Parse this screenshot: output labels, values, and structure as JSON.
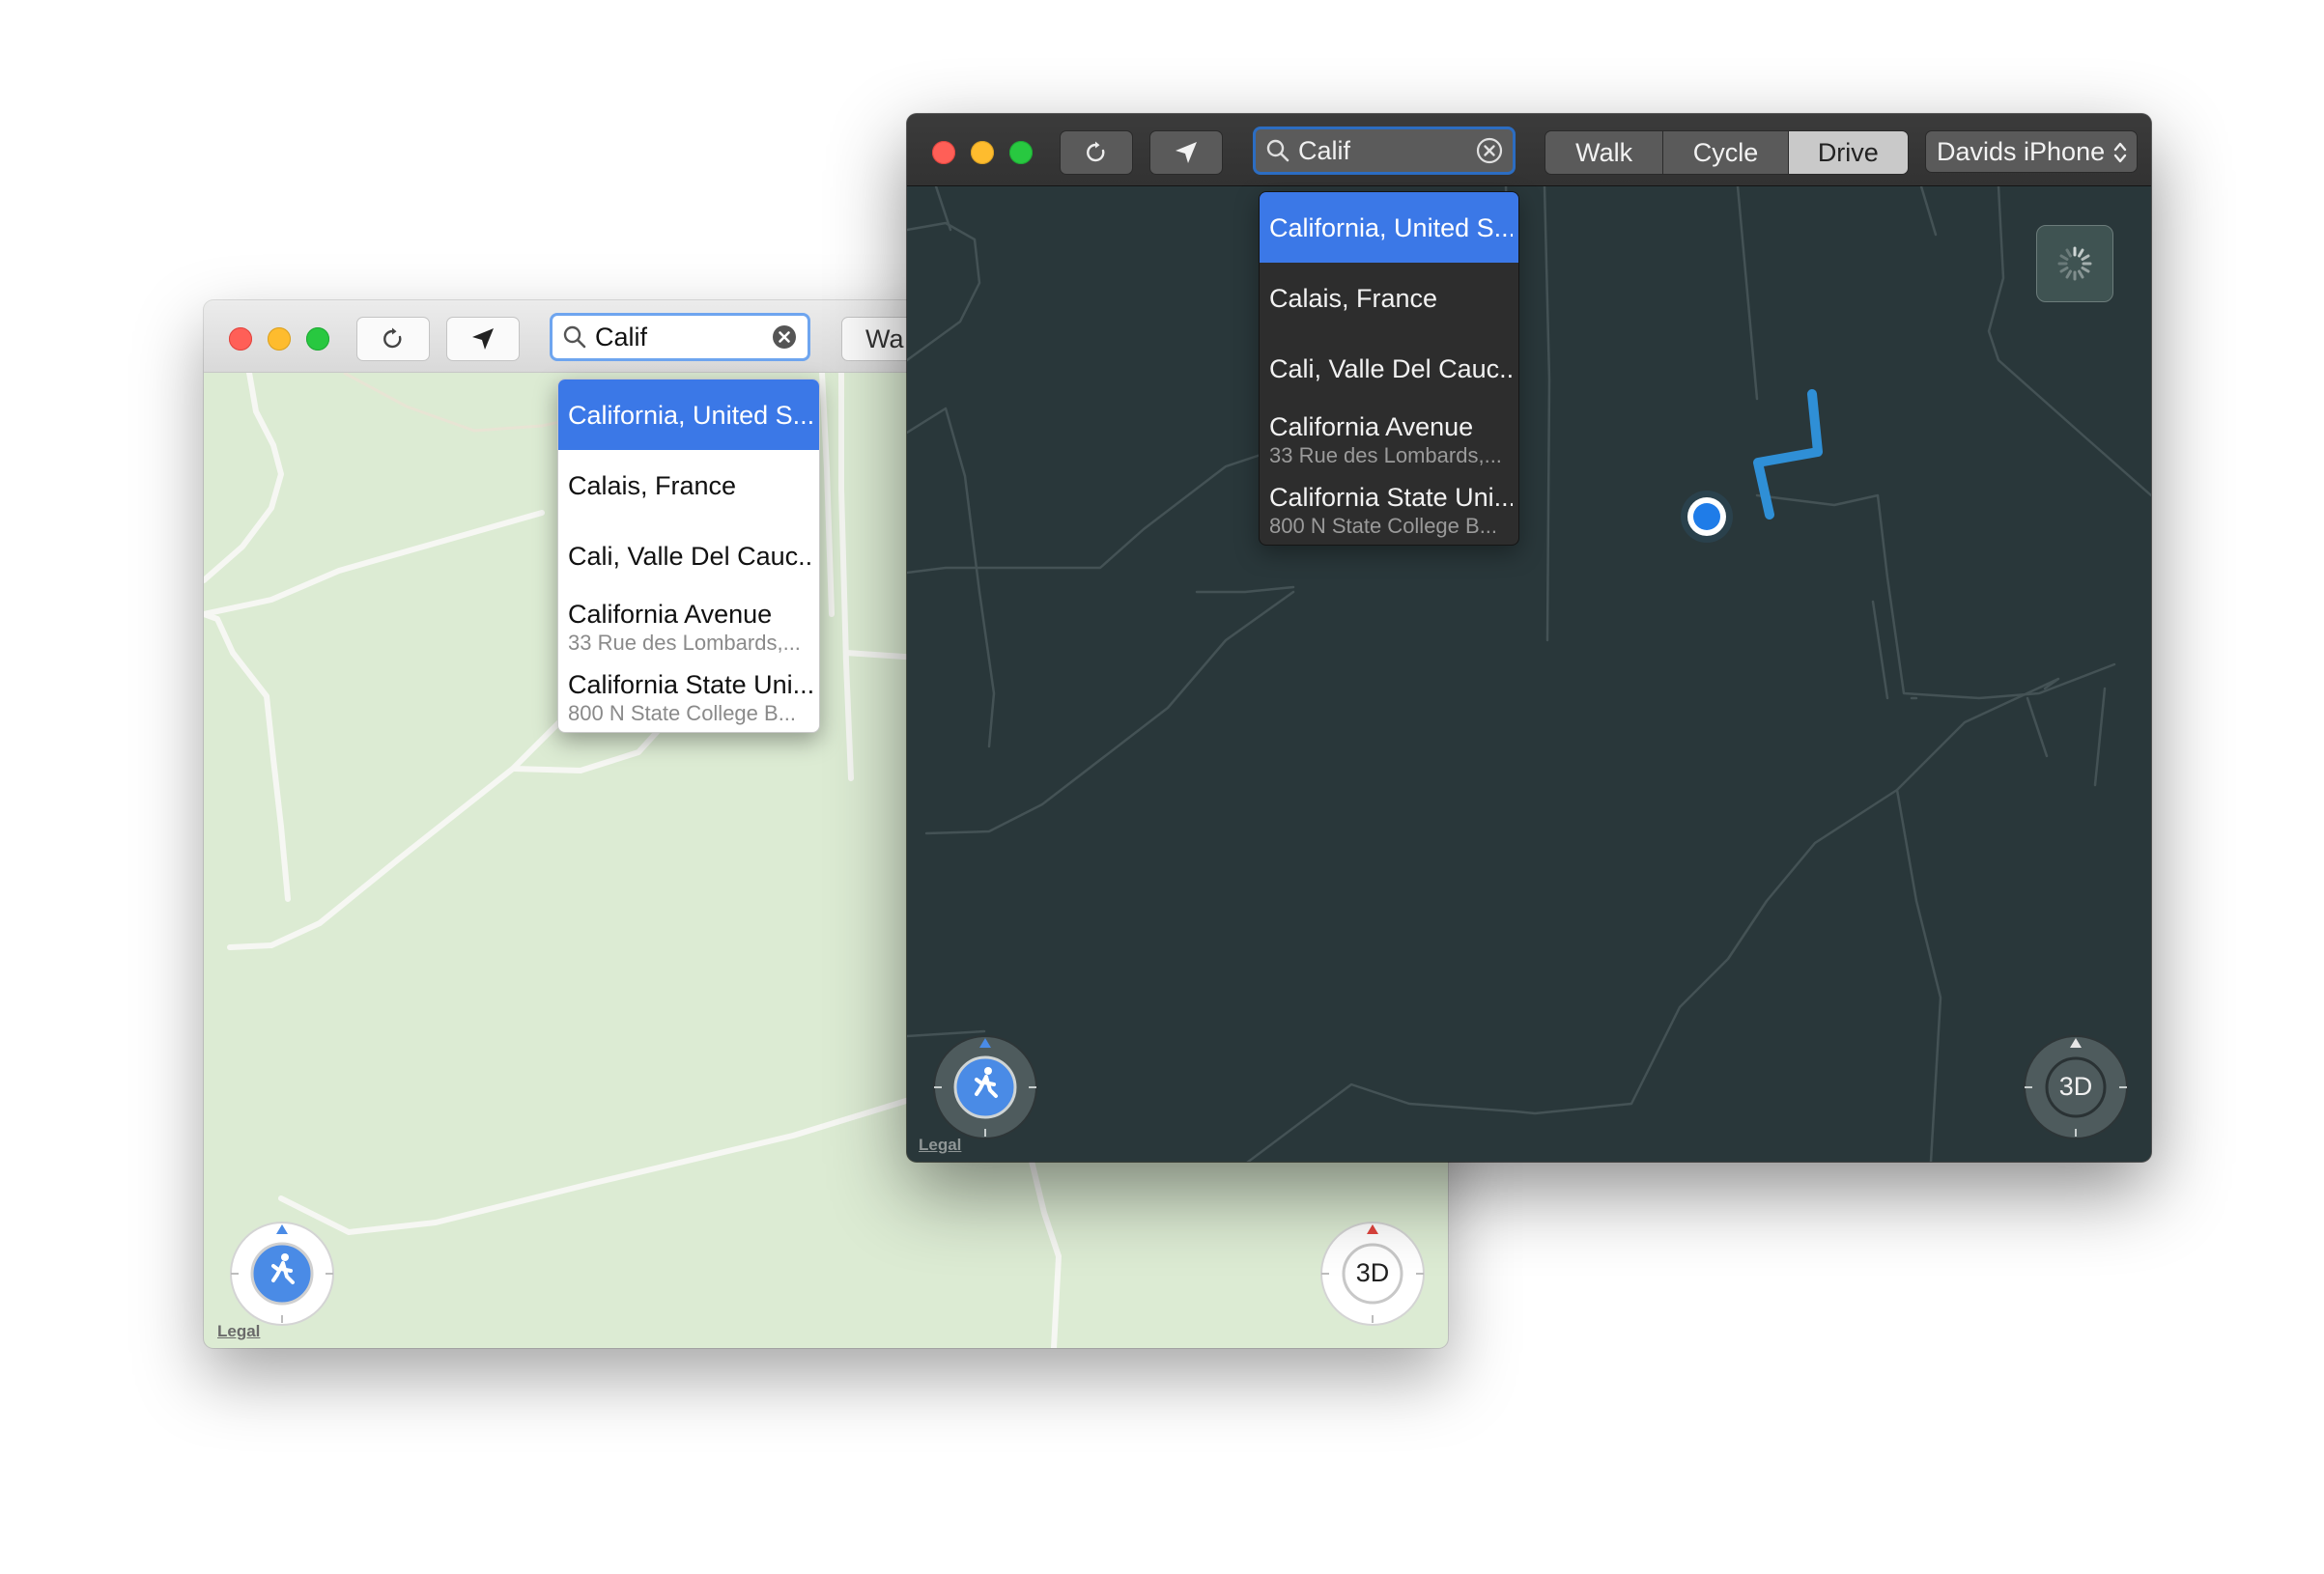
{
  "colors": {
    "accent_blue": "#3b78e7",
    "route_blue": "#2f8fd6",
    "light_map": "#dcebd3",
    "dark_map": "#29373a",
    "traffic_red": "#ff5f57",
    "traffic_yellow": "#febc2e",
    "traffic_green": "#28c840"
  },
  "light_window": {
    "toolbar": {
      "refresh_icon": "refresh-icon",
      "location_icon": "location-arrow-icon",
      "search": {
        "query": "Calif",
        "icon": "search-icon",
        "clear_icon": "clear-icon"
      },
      "transport_partial_label": "Wa"
    },
    "suggestions": [
      {
        "title": "California, United S...",
        "subtitle": "",
        "selected": true
      },
      {
        "title": "Calais, France",
        "subtitle": "",
        "selected": false
      },
      {
        "title": "Cali, Valle Del Cauc...",
        "subtitle": "",
        "selected": false
      },
      {
        "title": "California Avenue",
        "subtitle": "33 Rue des Lombards,...",
        "selected": false
      },
      {
        "title": "California State Uni...",
        "subtitle": "800 N State College B...",
        "selected": false
      }
    ],
    "compass_icon": "walking-person-icon",
    "threed_label": "3D",
    "legal": "Legal"
  },
  "dark_window": {
    "toolbar": {
      "refresh_icon": "refresh-icon",
      "location_icon": "location-arrow-icon",
      "search": {
        "query": "Calif",
        "icon": "search-icon",
        "clear_icon": "clear-icon"
      },
      "transport": [
        {
          "label": "Walk",
          "selected": false
        },
        {
          "label": "Cycle",
          "selected": false
        },
        {
          "label": "Drive",
          "selected": true
        }
      ],
      "device_label": "Davids iPhone"
    },
    "suggestions": [
      {
        "title": "California, United S...",
        "subtitle": "",
        "selected": true
      },
      {
        "title": "Calais, France",
        "subtitle": "",
        "selected": false
      },
      {
        "title": "Cali, Valle Del Cauc...",
        "subtitle": "",
        "selected": false
      },
      {
        "title": "California Avenue",
        "subtitle": "33 Rue des Lombards,...",
        "selected": false
      },
      {
        "title": "California State Uni...",
        "subtitle": "800 N State College B...",
        "selected": false
      }
    ],
    "compass_icon": "walking-person-icon",
    "threed_label": "3D",
    "legal": "Legal",
    "loading_icon": "spinner-icon"
  }
}
